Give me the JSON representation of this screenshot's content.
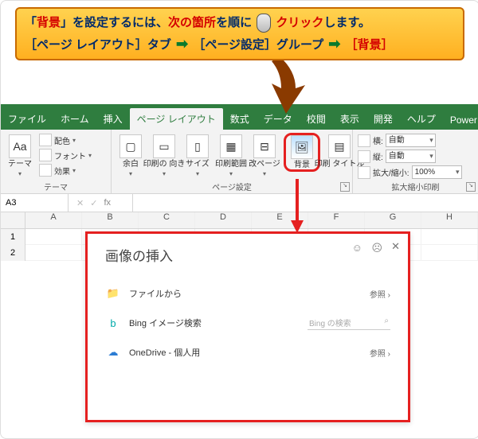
{
  "callout": {
    "l1_a": "「",
    "l1_b": "背景",
    "l1_c": "」を設定するには、",
    "l1_d": "次の箇所",
    "l1_e": "を順に",
    "l1_f": "クリック",
    "l1_g": "します。",
    "l2_a": "［ページ レイアウト］タブ",
    "l2_b": "［ページ設定］グループ",
    "l2_c": "［背景］"
  },
  "tabs": {
    "file": "ファイル",
    "home": "ホーム",
    "insert": "挿入",
    "layout": "ページ レイアウト",
    "formulas": "数式",
    "data": "データ",
    "review": "校閲",
    "view": "表示",
    "dev": "開発",
    "help": "ヘルプ",
    "pp": "Power Pivot"
  },
  "themes": {
    "group": "テーマ",
    "themes": "テーマ",
    "colors": "配色",
    "fonts": "フォント",
    "effects": "効果"
  },
  "page_setup": {
    "group": "ページ設定",
    "margins": "余白",
    "orientation": "印刷の\n向き",
    "size": "サイズ",
    "print_area": "印刷範囲",
    "breaks": "改ページ",
    "background": "背景",
    "titles": "印刷\nタイトル"
  },
  "scale": {
    "group": "拡大縮小印刷",
    "width_label": "横:",
    "height_label": "縦:",
    "auto": "自動",
    "scale_label": "拡大/縮小:",
    "scale_val": "100%"
  },
  "namebox": "A3",
  "fx_label": "fx",
  "cols": [
    "A",
    "B",
    "C",
    "D",
    "E",
    "F",
    "G",
    "H"
  ],
  "rows": [
    "1",
    "2"
  ],
  "dialog": {
    "title": "画像の挿入",
    "from_file": "ファイルから",
    "bing": "Bing イメージ検索",
    "onedrive": "OneDrive - 個人用",
    "browse": "参照 ›",
    "search_placeholder": "Bing の検索",
    "search_icon": "⌕"
  }
}
